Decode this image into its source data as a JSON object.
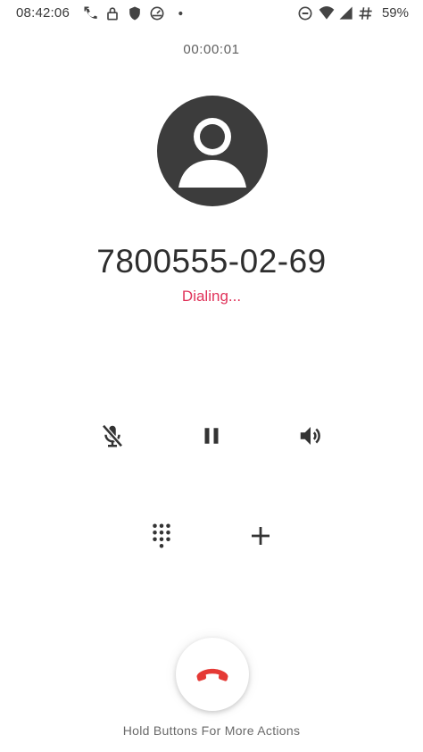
{
  "status_bar": {
    "time": "08:42:06",
    "battery_percent": "59%",
    "left_icons": [
      "missed-call-icon",
      "lock-icon",
      "shield-icon",
      "speed-gauge-icon",
      "notification-dot-icon"
    ],
    "right_icons": [
      "do-not-disturb-icon",
      "wifi-icon",
      "cell-signal-icon",
      "hash-icon"
    ]
  },
  "call": {
    "timer": "00:00:01",
    "number": "7800555-02-69",
    "status": "Dialing...",
    "status_color": "#e0335a"
  },
  "controls": {
    "row1": [
      "mute-icon",
      "hold-icon",
      "speaker-icon"
    ],
    "row2": [
      "dialpad-icon",
      "add-call-icon"
    ]
  },
  "end_call": {
    "icon": "hang-up-icon",
    "color": "#e53935"
  },
  "hint": "Hold Buttons For More Actions"
}
